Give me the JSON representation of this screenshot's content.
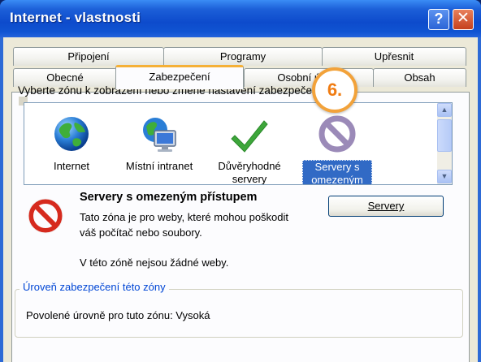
{
  "window": {
    "title": "Internet - vlastnosti",
    "help_glyph": "?",
    "close_glyph": "✕"
  },
  "tabs": {
    "row1": [
      "Připojení",
      "Programy",
      "Upřesnit"
    ],
    "row2": [
      "Obecné",
      "Zabezpečení",
      "Osobní údaje",
      "Obsah"
    ],
    "active": "Zabezpečení"
  },
  "security": {
    "prompt": "Vyberte zónu k zobrazení nebo změně nastavení zabezpečení.",
    "callout": "6.",
    "zones": [
      {
        "label": "Internet",
        "icon": "globe-icon"
      },
      {
        "label": "Místní intranet",
        "icon": "intranet-icon"
      },
      {
        "label": "Důvěryhodné servery",
        "icon": "checkmark-icon"
      },
      {
        "label": "Servery s omezeným přístupem",
        "icon": "restricted-icon",
        "selected": true
      }
    ],
    "zone_info": {
      "title": "Servery s omezeným přístupem",
      "description": "Tato zóna je pro weby, které mohou poškodit váš počítač nebo soubory.",
      "empty_note": "V této zóně nejsou žádné weby."
    },
    "servers_button": "Servery",
    "level_group": {
      "legend": "Úroveň zabezpečení této zóny",
      "allowed_levels": "Povolené úrovně pro tuto zónu: Vysoká"
    }
  },
  "colors": {
    "titlebar": "#0d4bcc",
    "dialog_bg": "#ece9d8",
    "selection": "#316ac5",
    "callout_border": "#f2a23a",
    "restricted_red": "#d62a1e"
  }
}
